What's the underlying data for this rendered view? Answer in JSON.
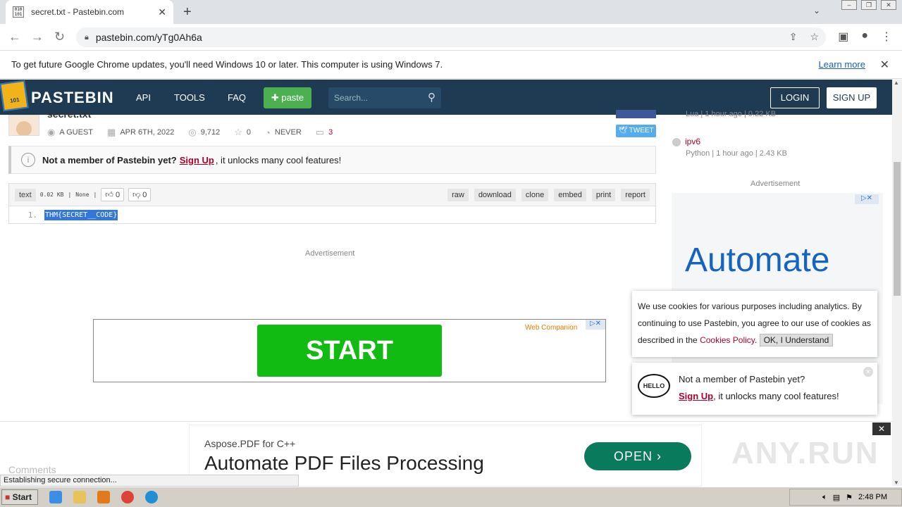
{
  "browser": {
    "tab_title": "secret.txt - Pastebin.com",
    "tab_close": "✕",
    "new_tab": "+",
    "url": "pastebin.com/yTg0Ah6a",
    "infobar_text": "To get future Google Chrome updates, you'll need Windows 10 or later. This computer is using Windows 7.",
    "infobar_link": "Learn more",
    "infobar_close": "✕"
  },
  "header": {
    "logo": "PASTEBIN",
    "logo_badge": "101",
    "nav": [
      "API",
      "TOOLS",
      "FAQ"
    ],
    "paste_button": "paste",
    "search_placeholder": "Search...",
    "login": "LOGIN",
    "signup": "SIGN UP"
  },
  "paste": {
    "title": "secret.txt",
    "author": "A GUEST",
    "date": "APR 6TH, 2022",
    "views": "9,712",
    "stars": "0",
    "expires": "NEVER",
    "comments_count": "3",
    "tweet": "TWEET",
    "syntax": "text",
    "size": "0.02 KB",
    "category": "None",
    "likes": "0",
    "dislikes": "0",
    "actions": [
      "raw",
      "download",
      "clone",
      "embed",
      "print",
      "report"
    ],
    "line_number": "1.",
    "code": "THM{SECRET__CODE}"
  },
  "notice": {
    "prefix": "Not a member of Pastebin yet?",
    "link": "Sign Up",
    "suffix": ", it unlocks many cool features!"
  },
  "ads": {
    "label": "Advertisement",
    "banner_button": "START",
    "banner_brand": "Web Companion",
    "side_headline": "Automate",
    "sticky_brand": "Aspose.PDF for C++",
    "sticky_headline": "Automate PDF Files Processing",
    "sticky_button": "OPEN"
  },
  "sidebar": {
    "items": [
      {
        "name": "",
        "meta": "Lua | 1 hour ago | 0.22 KB"
      },
      {
        "name": "ipv6",
        "meta": "Python | 1 hour ago | 2.43 KB"
      }
    ]
  },
  "cookie": {
    "text": "We use cookies for various purposes including analytics. By continuing to use Pastebin, you agree to our use of cookies as described in the",
    "link": "Cookies Policy",
    "button": "OK, I Understand"
  },
  "hello_popup": {
    "bubble": "HELLO",
    "line1": "Not a member of Pastebin yet?",
    "link": "Sign Up",
    "line2_suffix": ", it unlocks many cool features!"
  },
  "comments_heading": "Comments",
  "status_text": "Establishing secure connection...",
  "watermark": "ANY.RUN",
  "taskbar": {
    "start": "Start",
    "time": "2:48 PM"
  }
}
